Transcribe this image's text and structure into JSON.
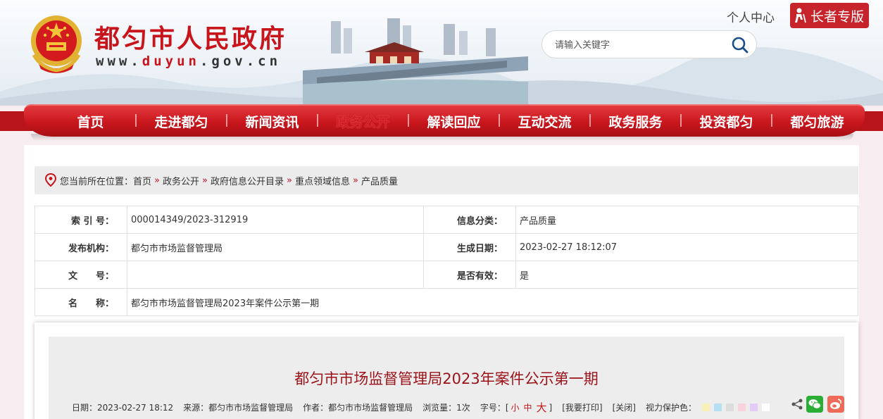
{
  "header": {
    "site_title": "都匀市人民政府",
    "url_prefix": "www.",
    "url_domain": "duyun",
    "url_suffix": ".gov.cn",
    "personal_center": "个人中心",
    "elder_mode": "长者专版",
    "search_placeholder": "请输入关键字"
  },
  "nav": {
    "items": [
      {
        "label": "首页"
      },
      {
        "label": "走进都匀"
      },
      {
        "label": "新闻资讯"
      },
      {
        "label": "政务公开"
      },
      {
        "label": "解读回应"
      },
      {
        "label": "互动交流"
      },
      {
        "label": "政务服务"
      },
      {
        "label": "投资都匀"
      },
      {
        "label": "都匀旅游"
      }
    ],
    "active_label": "政务公开"
  },
  "breadcrumb": {
    "prefix": "您当前所在位置：",
    "items": [
      "首页",
      "政务公开",
      "政府信息公开目录",
      "重点领域信息",
      "产品质量"
    ],
    "separator": "»"
  },
  "info_table": {
    "index_label": "索 引 号：",
    "index_value": "000014349/2023-312919",
    "category_label": "信息分类：",
    "category_value": "产品质量",
    "publisher_label": "发布机构：",
    "publisher_value": "都匀市市场监督管理局",
    "date_label": "生成日期：",
    "date_value": "2023-02-27 18:12:07",
    "docno_label": "文　　号：",
    "docno_value": "",
    "valid_label": "是否有效：",
    "valid_value": "是",
    "name_label": "名　　称：",
    "name_value": "都匀市市场监督管理局2023年案件公示第一期"
  },
  "article": {
    "title": "都匀市市场监督管理局2023年案件公示第一期",
    "date": "日期：2023-02-27 18:12",
    "source": "来源：都匀市市场监督管理局",
    "author": "作者：都匀市市场监督管理局",
    "views": "浏览量：1次",
    "fontsize_label": "字号：[",
    "fontsize_small": "小",
    "fontsize_mid": "中",
    "fontsize_large": "大",
    "fontsize_close": "]",
    "print": "[我要打印]",
    "close": "[关闭]",
    "eye_label": "视力保护色："
  },
  "colors": {
    "brand_red": "#c8151c",
    "swatches": [
      "#f7f0b8",
      "#b5e0f4",
      "#dcdcdc",
      "#f8d2dc",
      "#e2ccf5",
      "#ffffff"
    ]
  }
}
